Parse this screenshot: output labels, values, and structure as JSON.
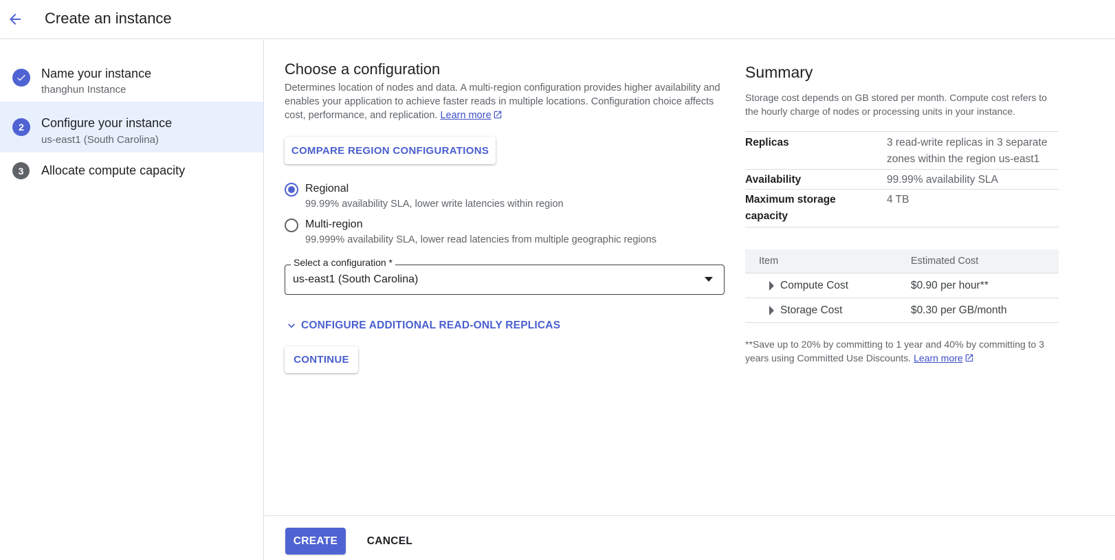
{
  "header": {
    "title": "Create an instance",
    "back_icon": "arrow-back-icon"
  },
  "stepper": {
    "steps": [
      {
        "number": "1",
        "title": "Name your instance",
        "subtitle": "thanghun Instance",
        "state": "complete"
      },
      {
        "number": "2",
        "title": "Configure your instance",
        "subtitle": "us-east1 (South Carolina)",
        "state": "active"
      },
      {
        "number": "3",
        "title": "Allocate compute capacity",
        "subtitle": "",
        "state": "pending"
      }
    ]
  },
  "main": {
    "heading": "Choose a configuration",
    "description": "Determines location of nodes and data. A multi-region configuration provides higher availability and enables your application to achieve faster reads in multiple locations. Configuration choice affects cost, performance, and replication.",
    "learn_more": "Learn more",
    "compare_button": "COMPARE REGION CONFIGURATIONS",
    "options": [
      {
        "label": "Regional",
        "description": "99.99% availability SLA, lower write latencies within region",
        "checked": true
      },
      {
        "label": "Multi-region",
        "description": "99.999% availability SLA, lower read latencies from multiple geographic regions",
        "checked": false
      }
    ],
    "select": {
      "label": "Select a configuration *",
      "value": "us-east1 (South Carolina)"
    },
    "expander": "CONFIGURE ADDITIONAL READ-ONLY REPLICAS",
    "continue_button": "CONTINUE"
  },
  "summary": {
    "title": "Summary",
    "description": "Storage cost depends on GB stored per month. Compute cost refers to the hourly charge of nodes or processing units in your instance.",
    "rows": [
      {
        "key": "Replicas",
        "value": "3 read-write replicas in 3 separate zones within the region us-east1"
      },
      {
        "key": "Availability",
        "value": "99.99% availability SLA"
      },
      {
        "key": "Maximum storage capacity",
        "value": "4 TB"
      }
    ],
    "cost_table": {
      "headers": [
        "Item",
        "Estimated Cost"
      ],
      "rows": [
        {
          "item": "Compute Cost",
          "cost": "$0.90 per hour**"
        },
        {
          "item": "Storage Cost",
          "cost": "$0.30 per GB/month"
        }
      ]
    },
    "footnote": "**Save up to 20% by committing to 1 year and 40% by committing to 3 years using Committed Use Discounts.",
    "learn_more": "Learn more"
  },
  "footer": {
    "create_button": "CREATE",
    "cancel_button": "CANCEL"
  },
  "colors": {
    "accent": "#4f63d2",
    "link": "#3c4ec6",
    "active_step_bg": "#e8f0fe"
  }
}
